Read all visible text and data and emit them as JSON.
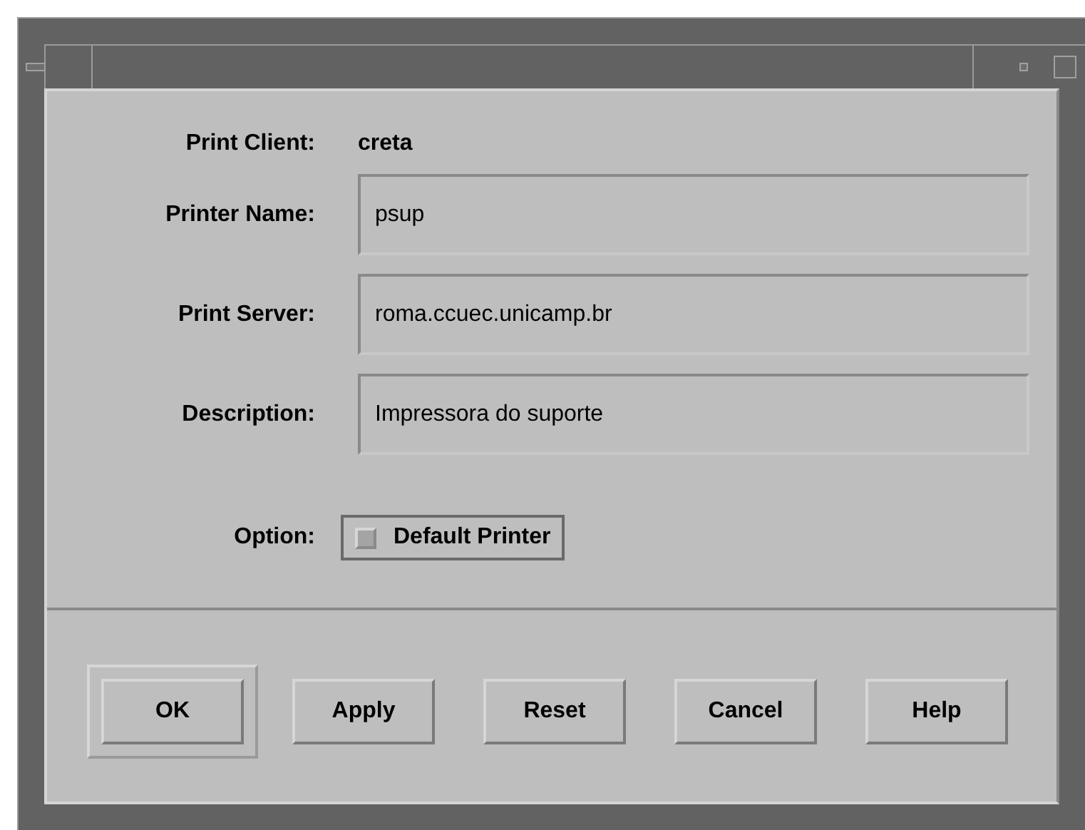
{
  "print_client": {
    "label": "Print Client:",
    "value": "creta"
  },
  "fields": [
    {
      "label": "Printer Name:",
      "value": "psup"
    },
    {
      "label": "Print Server:",
      "value": "roma.ccuec.unicamp.br"
    },
    {
      "label": "Description:",
      "value": "Impressora do suporte"
    }
  ],
  "option": {
    "label": "Option:",
    "checkbox": {
      "label": "Default Printer",
      "checked": false
    }
  },
  "buttons": [
    {
      "label": "OK",
      "default": true
    },
    {
      "label": "Apply",
      "default": false
    },
    {
      "label": "Reset",
      "default": false
    },
    {
      "label": "Cancel",
      "default": false
    },
    {
      "label": "Help",
      "default": false
    }
  ]
}
